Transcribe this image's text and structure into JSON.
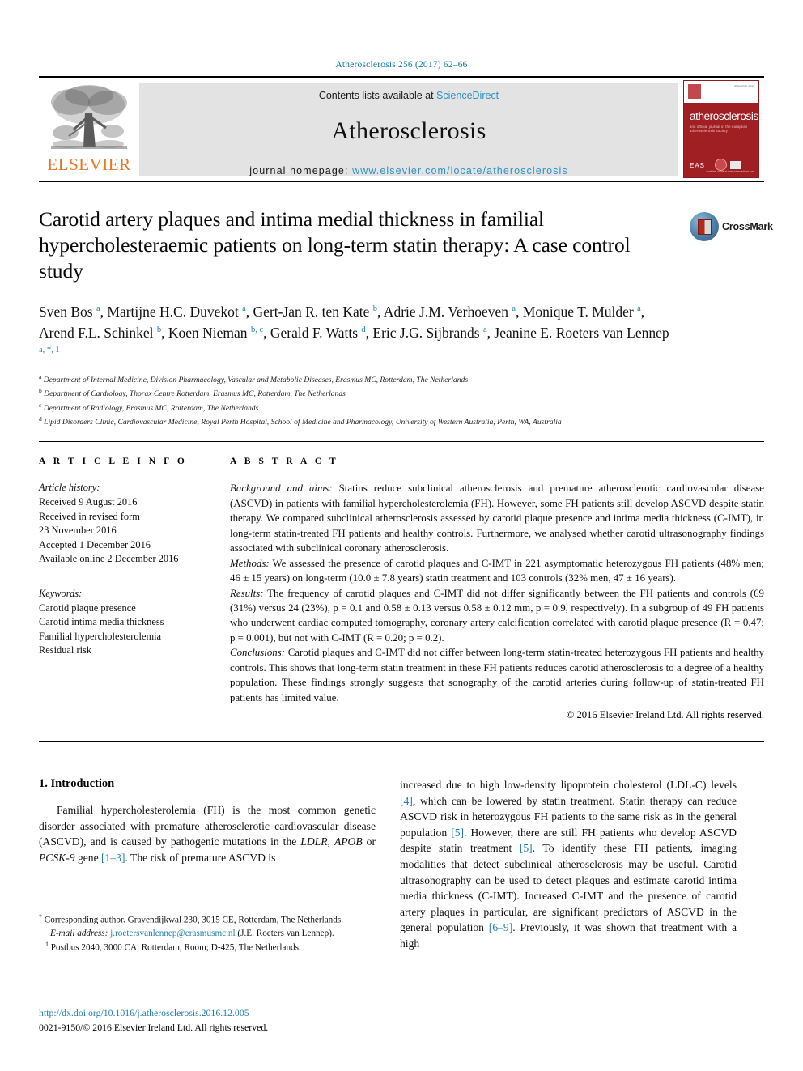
{
  "running_head": "Atherosclerosis 256 (2017) 62–66",
  "masthead": {
    "publisher_name": "ELSEVIER",
    "contents_prefix": "Contents lists available at ",
    "contents_link": "ScienceDirect",
    "journal_name": "Atherosclerosis",
    "homepage_prefix": "journal homepage: ",
    "homepage_url": "www.elsevier.com/locate/atherosclerosis",
    "cover": {
      "title": "atherosclerosis",
      "subtitle": "and official journal of the european atherosclerosis society",
      "society": "EAS",
      "issn": "ISSN 0021-9150",
      "footer": "Available online at www.sciencedirect.com"
    }
  },
  "article": {
    "title": "Carotid artery plaques and intima medial thickness in familial hypercholesteraemic patients on long-term statin therapy: A case control study",
    "crossmark_label": "CrossMark",
    "authors_html": "Sven Bos <sup>a</sup>, Martijne H.C. Duvekot <sup>a</sup>, Gert-Jan R. ten Kate <sup>b</sup>, Adrie J.M. Verhoeven <sup>a</sup>, Monique T. Mulder <sup>a</sup>, Arend F.L. Schinkel <sup>b</sup>, Koen Nieman <sup>b, c</sup>, Gerald F. Watts <sup>d</sup>, Eric J.G. Sijbrands <sup>a</sup>, Jeanine E. Roeters van Lennep <sup>a, *, 1</sup>",
    "affiliations": [
      {
        "marker": "a",
        "text": "Department of Internal Medicine, Division Pharmacology, Vascular and Metabolic Diseases, Erasmus MC, Rotterdam, The Netherlands"
      },
      {
        "marker": "b",
        "text": "Department of Cardiology, Thorax Centre Rotterdam, Erasmus MC, Rotterdam, The Netherlands"
      },
      {
        "marker": "c",
        "text": "Department of Radiology, Erasmus MC, Rotterdam, The Netherlands"
      },
      {
        "marker": "d",
        "text": "Lipid Disorders Clinic, Cardiovascular Medicine, Royal Perth Hospital, School of Medicine and Pharmacology, University of Western Australia, Perth, WA, Australia"
      }
    ]
  },
  "article_info": {
    "heading": "A R T I C L E  I N F O",
    "history_label": "Article history:",
    "history": [
      "Received 9 August 2016",
      "Received in revised form",
      "23 November 2016",
      "Accepted 1 December 2016",
      "Available online 2 December 2016"
    ],
    "keywords_label": "Keywords:",
    "keywords": [
      "Carotid plaque presence",
      "Carotid intima media thickness",
      "Familial hypercholesterolemia",
      "Residual risk"
    ]
  },
  "abstract": {
    "heading": "A B S T R A C T",
    "sections": [
      {
        "label": "Background and aims:",
        "text": " Statins reduce subclinical atherosclerosis and premature atherosclerotic cardiovascular disease (ASCVD) in patients with familial hypercholesterolemia (FH). However, some FH patients still develop ASCVD despite statin therapy. We compared subclinical atherosclerosis assessed by carotid plaque presence and intima media thickness (C-IMT), in long-term statin-treated FH patients and healthy controls. Furthermore, we analysed whether carotid ultrasonography findings associated with subclinical coronary atherosclerosis."
      },
      {
        "label": "Methods:",
        "text": " We assessed the presence of carotid plaques and C-IMT in 221 asymptomatic heterozygous FH patients (48% men; 46 ± 15 years) on long-term (10.0 ± 7.8 years) statin treatment and 103 controls (32% men, 47 ± 16 years)."
      },
      {
        "label": "Results:",
        "text": " The frequency of carotid plaques and C-IMT did not differ significantly between the FH patients and controls (69 (31%) versus 24 (23%), p = 0.1 and 0.58 ± 0.13 versus 0.58 ± 0.12 mm, p = 0.9, respectively). In a subgroup of 49 FH patients who underwent cardiac computed tomography, coronary artery calcification correlated with carotid plaque presence (R = 0.47; p = 0.001), but not with C-IMT (R = 0.20; p = 0.2)."
      },
      {
        "label": "Conclusions:",
        "text": " Carotid plaques and C-IMT did not differ between long-term statin-treated heterozygous FH patients and healthy controls. This shows that long-term statin treatment in these FH patients reduces carotid atherosclerosis to a degree of a healthy population. These findings strongly suggests that sonography of the carotid arteries during follow-up of statin-treated FH patients has limited value."
      }
    ],
    "copyright": "© 2016 Elsevier Ireland Ltd. All rights reserved."
  },
  "introduction": {
    "heading": "1. Introduction",
    "left_paragraph_html": "Familial hypercholesterolemia (FH) is the most common genetic disorder associated with premature atherosclerotic cardiovascular disease (ASCVD), and is caused by pathogenic mutations in the <span class=\"it\">LDLR</span>, <span class=\"it\">APOB</span> or <span class=\"it\">PCSK-9</span> gene <span class=\"ref\">[1–3]</span>. The risk of premature ASCVD is",
    "right_paragraph_html": "increased due to high low-density lipoprotein cholesterol (LDL-C) levels <span class=\"ref\">[4]</span>, which can be lowered by statin treatment. Statin therapy can reduce ASCVD risk in heterozygous FH patients to the same risk as in the general population <span class=\"ref\">[5]</span>. However, there are still FH patients who develop ASCVD despite statin treatment <span class=\"ref\">[5]</span>. To identify these FH patients, imaging modalities that detect subclinical atherosclerosis may be useful. Carotid ultrasonography can be used to detect plaques and estimate carotid intima media thickness (C-IMT). Increased C-IMT and the presence of carotid artery plaques in particular, are significant predictors of ASCVD in the general population <span class=\"ref\">[6–9]</span>. Previously, it was shown that treatment with a high"
  },
  "footnotes": {
    "corresponding_html": "<sup>*</sup> Corresponding author. Gravendijkwal 230, 3015 CE, Rotterdam, The Netherlands.",
    "email_html": "<span class=\"it\">E-mail address:</span> <span class=\"fn-link\">j.roetersvanlennep@erasmusmc.nl</span> (J.E. Roeters van Lennep).",
    "postal_html": "<sup>1</sup> Postbus 2040, 3000 CA, Rotterdam, Room; D-425, The Netherlands."
  },
  "doi_block": {
    "doi_url": "http://dx.doi.org/10.1016/j.atherosclerosis.2016.12.005",
    "issn_line": "0021-9150/© 2016 Elsevier Ireland Ltd. All rights reserved."
  }
}
